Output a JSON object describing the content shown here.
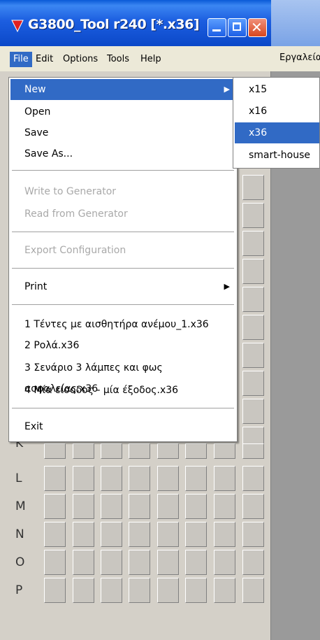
{
  "window": {
    "title": "G3800_Tool r240 [*.x36]"
  },
  "menubar": [
    "File",
    "Edit",
    "Options",
    "Tools",
    "Help"
  ],
  "background_window": {
    "menu_label": "Εργαλεία"
  },
  "file_menu": {
    "new": "New",
    "open": "Open",
    "save": "Save",
    "save_as": "Save As...",
    "write_gen": "Write to Generator",
    "read_gen": "Read from Generator",
    "export": "Export Configuration",
    "print": "Print",
    "recent": [
      "1 Τέντες με αισθητήρα ανέμου_1.x36",
      "2 Ρολά.x36",
      "3 Σενάριο 3 λάμπες και φως ασφαλείας.x36",
      "4 Μία είσοδος - μία έξοδος.x36"
    ],
    "exit": "Exit"
  },
  "new_submenu": [
    "x15",
    "x16",
    "x36",
    "smart-house"
  ],
  "grid_rows": [
    "K",
    "L",
    "M",
    "N",
    "O",
    "P"
  ],
  "colors": {
    "highlight": "#316ac5",
    "titlebar": "#0b48c8"
  }
}
